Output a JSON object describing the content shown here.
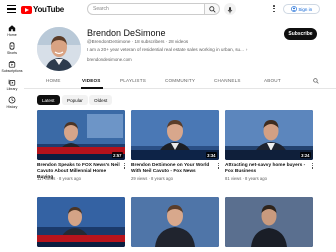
{
  "header": {
    "logo_text": "YouTube",
    "search_placeholder": "Search",
    "signin_label": "Sign in"
  },
  "rail": [
    {
      "icon": "home-icon",
      "label": "Home"
    },
    {
      "icon": "shorts-icon",
      "label": "Shorts"
    },
    {
      "icon": "subscriptions-icon",
      "label": "Subscriptions"
    },
    {
      "icon": "library-icon",
      "label": "Library"
    },
    {
      "icon": "history-icon",
      "label": "History"
    }
  ],
  "channel": {
    "name": "Brendon DeSimone",
    "meta": "@BrendonDeSimone · 18 subscribers · 28 videos",
    "description": "I am a 20+ year veteran of residential real estate sales working in urban, su...",
    "link": "brendondesimone.com",
    "subscribe_label": "Subscribe"
  },
  "tabs": [
    "HOME",
    "VIDEOS",
    "PLAYLISTS",
    "COMMUNITY",
    "CHANNELS",
    "ABOUT"
  ],
  "active_tab": "VIDEOS",
  "chips": [
    "Latest",
    "Popular",
    "Oldest"
  ],
  "active_chip": "Latest",
  "videos": [
    {
      "title": "Brendon Speaks to FOX News's Neil Cavuto About Millennial Home Buying",
      "meta": "117 views · 8 years ago",
      "duration": "2:57"
    },
    {
      "title": "Brendon DeSimone on Your World With Neil Cavuto - Fox News",
      "meta": "29 views · 8 years ago",
      "duration": "3:34"
    },
    {
      "title": "Attracting net-savvy home buyers - Fox Business",
      "meta": "81 views · 8 years ago",
      "duration": "3:24"
    },
    {
      "title": "",
      "meta": "",
      "duration": ""
    },
    {
      "title": "",
      "meta": "",
      "duration": ""
    },
    {
      "title": "",
      "meta": "",
      "duration": ""
    }
  ],
  "colors": {
    "brand_red": "#ff0000",
    "link_blue": "#065fd4",
    "text_primary": "#0f0f0f",
    "text_secondary": "#606060"
  }
}
